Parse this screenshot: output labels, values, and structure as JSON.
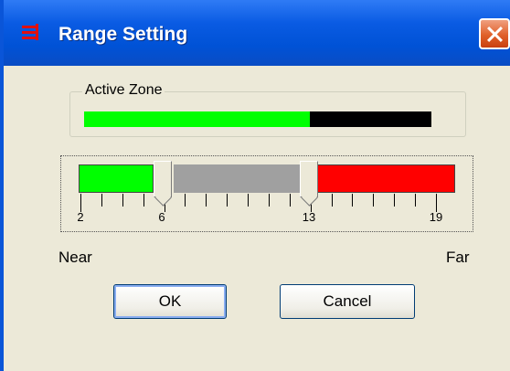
{
  "dialog": {
    "title": "Range Setting",
    "close_icon": "close-icon",
    "title_icon": "range-app-icon"
  },
  "active_zone": {
    "label": "Active Zone",
    "fill_fraction": 0.65,
    "fill_color": "#00ff00",
    "track_color": "#000000"
  },
  "range_slider": {
    "min": 2,
    "max": 19,
    "low_thumb": 6,
    "high_thumb": 13,
    "tick_labels": [
      "2",
      "6",
      "13",
      "19"
    ],
    "near_color": "#00ff00",
    "mid_color": "#a0a0a0",
    "far_color": "#ff0000"
  },
  "labels": {
    "near": "Near",
    "far": "Far"
  },
  "buttons": {
    "ok": "OK",
    "cancel": "Cancel"
  }
}
